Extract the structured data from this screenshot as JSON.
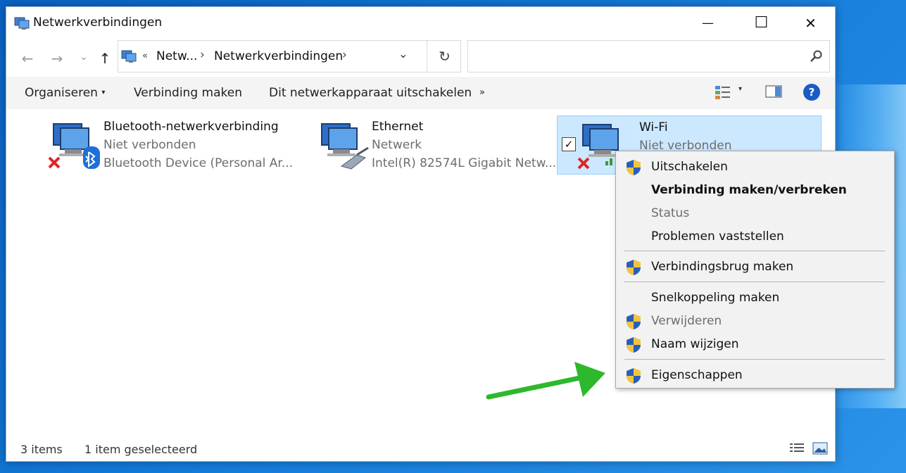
{
  "window": {
    "title": "Netwerkverbindingen",
    "minimize_glyph": "—",
    "maximize_glyph": "☐",
    "close_glyph": "✕"
  },
  "nav": {
    "back": "←",
    "forward": "→",
    "recent": "⌄",
    "up": "↑",
    "breadcrumb_overflow": "«",
    "breadcrumb": [
      "Netw...",
      "Netwerkverbindingen"
    ],
    "crumb_sep": "›",
    "dropdown": "⌄",
    "refresh": "↻",
    "search_placeholder": ""
  },
  "toolbar": {
    "organise": "Organiseren",
    "organise_caret": "▾",
    "connect": "Verbinding maken",
    "disable": "Dit netwerkapparaat uitschakelen",
    "more": "»",
    "view_caret": "▾",
    "help": "?"
  },
  "items": [
    {
      "name": "Bluetooth-netwerkverbinding",
      "status": "Niet verbonden",
      "device": "Bluetooth Device (Personal Ar...",
      "icon": "bluetooth-network-icon"
    },
    {
      "name": "Ethernet",
      "status": "Netwerk",
      "device": "Intel(R) 82574L Gigabit Netw...",
      "icon": "ethernet-network-icon"
    },
    {
      "name": "Wi-Fi",
      "status": "Niet verbonden",
      "device": "",
      "icon": "wifi-network-icon",
      "checked": "✓"
    }
  ],
  "context_menu": {
    "disable": "Uitschakelen",
    "connect_disconnect": "Verbinding maken/verbreken",
    "status": "Status",
    "diagnose": "Problemen vaststellen",
    "bridge": "Verbindingsbrug maken",
    "shortcut": "Snelkoppeling maken",
    "delete": "Verwijderen",
    "rename": "Naam wijzigen",
    "properties": "Eigenschappen"
  },
  "statusbar": {
    "count": "3 items",
    "selected": "1 item geselecteerd"
  },
  "colors": {
    "accent_arrow": "#2db82d",
    "selection": "#cce8ff",
    "help_blue": "#1a5bc4"
  }
}
